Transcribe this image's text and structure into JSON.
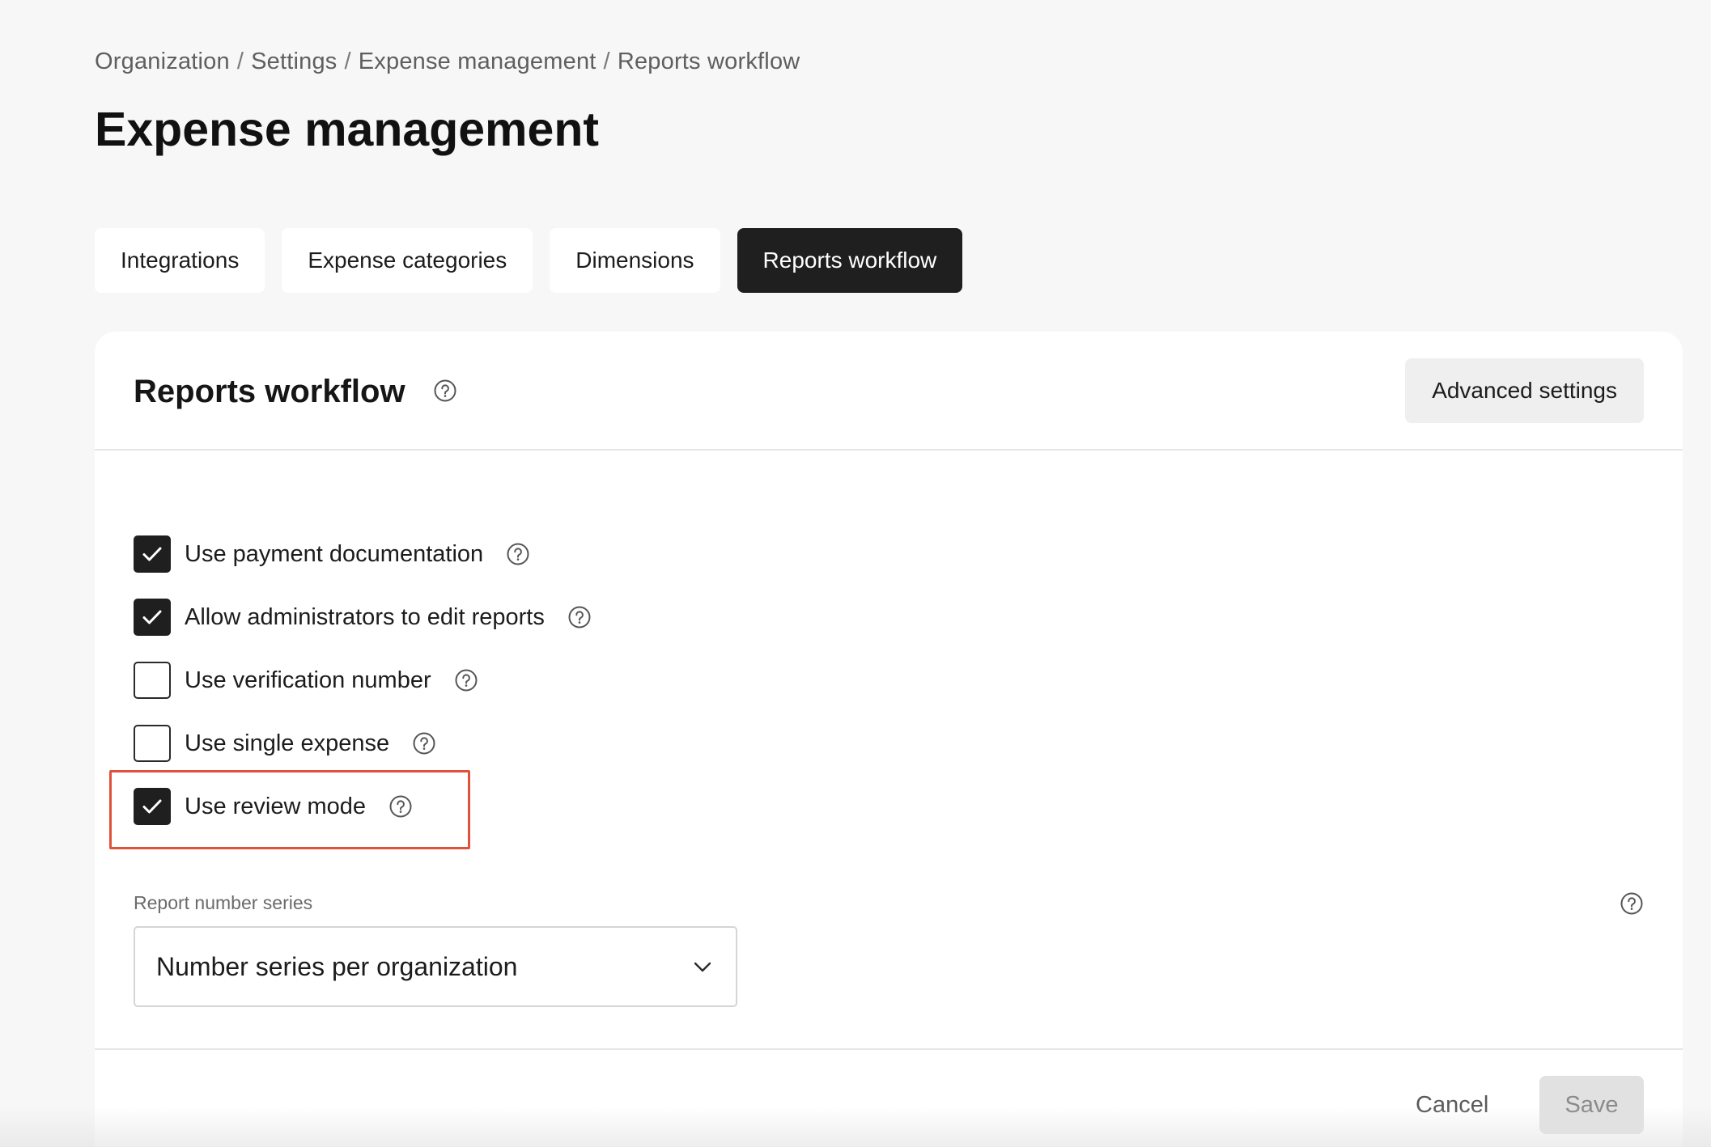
{
  "breadcrumb": {
    "items": [
      "Organization",
      "Settings",
      "Expense management",
      "Reports workflow"
    ],
    "separator": "/"
  },
  "page_title": "Expense management",
  "tabs": [
    {
      "label": "Integrations",
      "active": false
    },
    {
      "label": "Expense categories",
      "active": false
    },
    {
      "label": "Dimensions",
      "active": false
    },
    {
      "label": "Reports workflow",
      "active": true
    }
  ],
  "card": {
    "title": "Reports workflow",
    "advanced_settings_label": "Advanced settings",
    "options": [
      {
        "label": "Use payment documentation",
        "checked": true
      },
      {
        "label": "Allow administrators to edit reports",
        "checked": true
      },
      {
        "label": "Use verification number",
        "checked": false
      },
      {
        "label": "Use single expense",
        "checked": false
      },
      {
        "label": "Use review mode",
        "checked": true
      }
    ],
    "report_number_series": {
      "label": "Report number series",
      "selected": "Number series per organization"
    },
    "cancel_label": "Cancel",
    "save_label": "Save"
  },
  "colors": {
    "active_tab": "#1f1f1f",
    "highlight": "#e0513a",
    "page_bg": "#f7f7f7"
  },
  "icons": {
    "help": "question-circle-icon",
    "check": "checkmark-icon",
    "dropdown": "chevron-down-icon"
  }
}
